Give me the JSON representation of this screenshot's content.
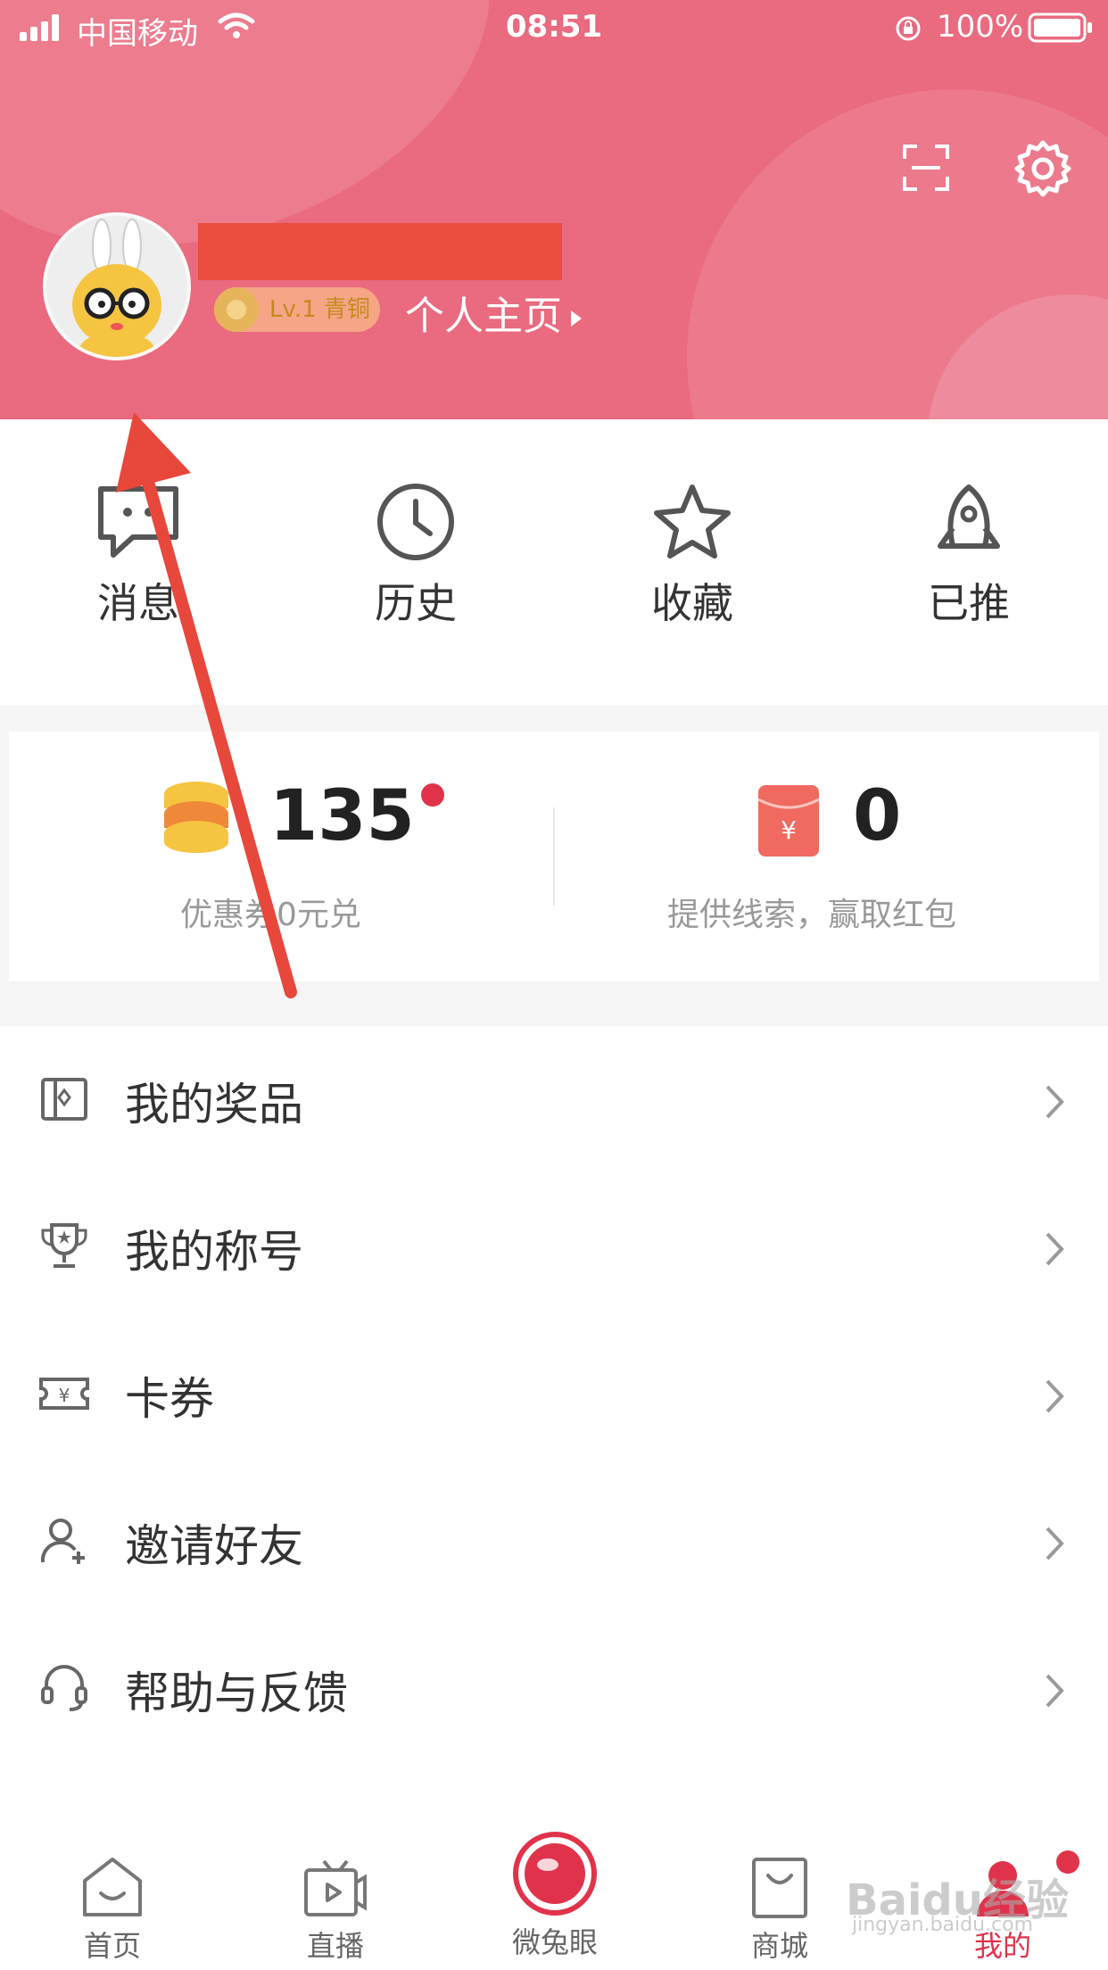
{
  "status_bar": {
    "carrier": "中国移动",
    "time": "08:51",
    "battery": "100%"
  },
  "profile": {
    "level": "Lv.1 青铜",
    "homepage_link": "个人主页"
  },
  "quick_actions": [
    {
      "label": "消息",
      "icon": "message-icon"
    },
    {
      "label": "历史",
      "icon": "clock-icon"
    },
    {
      "label": "收藏",
      "icon": "star-icon"
    },
    {
      "label": "已推",
      "icon": "rocket-icon"
    }
  ],
  "wallet": {
    "coins": {
      "value": "135",
      "caption": "优惠券0元兑"
    },
    "red_packet": {
      "value": "0",
      "caption": "提供线索，赢取红包"
    }
  },
  "menu": [
    {
      "label": "我的奖品",
      "icon": "gift-icon"
    },
    {
      "label": "我的称号",
      "icon": "trophy-icon"
    },
    {
      "label": "卡券",
      "icon": "ticket-icon"
    },
    {
      "label": "邀请好友",
      "icon": "invite-user-icon"
    },
    {
      "label": "帮助与反馈",
      "icon": "headset-icon"
    }
  ],
  "tabbar": [
    {
      "label": "首页",
      "icon": "home-icon"
    },
    {
      "label": "直播",
      "icon": "tv-icon"
    },
    {
      "label": "微兔眼",
      "icon": "eye-icon"
    },
    {
      "label": "商城",
      "icon": "bag-icon"
    },
    {
      "label": "我的",
      "icon": "user-icon",
      "active": true
    }
  ],
  "colors": {
    "header": "#ea6a7f",
    "accent": "#e0334b",
    "annotation": "#e8473b"
  },
  "watermark": {
    "text": "Baidu经验",
    "sub": "jingyan.baidu.com"
  }
}
